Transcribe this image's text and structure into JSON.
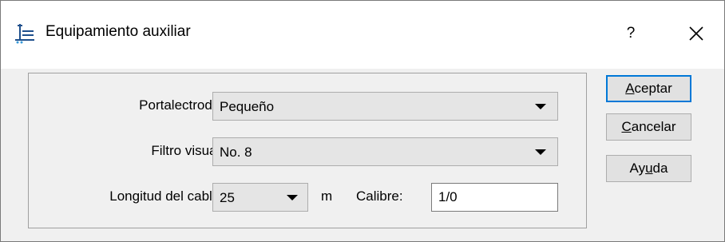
{
  "window": {
    "title": "Equipamiento auxiliar",
    "help_label": "?",
    "icon": "welding-equipment-icon"
  },
  "form": {
    "portalectrodo": {
      "label": "Portalectrodo:",
      "value": "Pequeño"
    },
    "filtro_visual": {
      "label": "Filtro visual:",
      "value": "No. 8"
    },
    "longitud_cable": {
      "label": "Longitud del cable:",
      "value": "25",
      "unit": "m"
    },
    "calibre": {
      "label": "Calibre:",
      "value": "1/0"
    }
  },
  "buttons": {
    "aceptar": {
      "mnemonic": "A",
      "rest": "ceptar"
    },
    "cancelar": {
      "mnemonic": "C",
      "rest": "ancelar"
    },
    "ayuda": {
      "pre": "Ay",
      "mnemonic": "u",
      "rest": "da"
    }
  },
  "colors": {
    "accent": "#0078d7",
    "face": "#f0f0f0",
    "button": "#e1e1e1"
  }
}
